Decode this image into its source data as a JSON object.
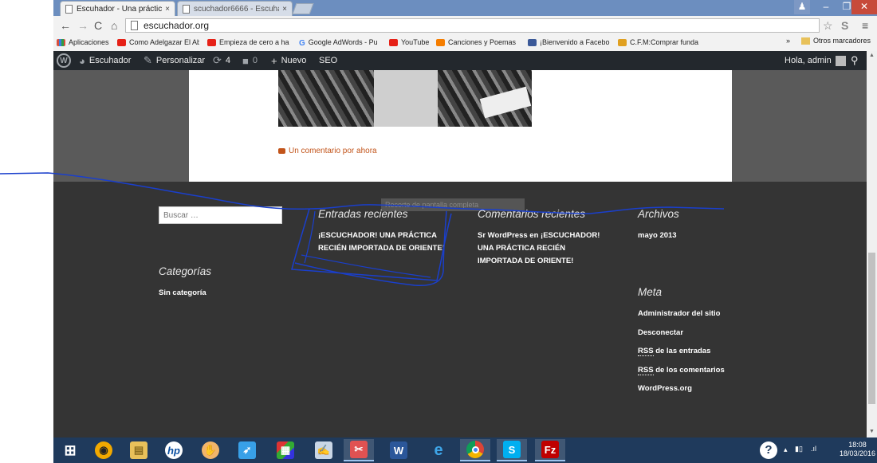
{
  "browser": {
    "tabs": [
      {
        "title": "Escuhador - Una práctica",
        "close": "×",
        "active": true
      },
      {
        "title": "scuchador6666 - Escuhad",
        "close": "×",
        "active": false
      }
    ],
    "url": "escuchador.org",
    "bookmarks": [
      {
        "label": "Aplicaciones",
        "icon": "apps-grid-icon",
        "color": "#d94f3d"
      },
      {
        "label": "Como Adelgazar El Ab",
        "icon": "youtube-icon",
        "color": "#e62117"
      },
      {
        "label": "Empieza de cero a ha",
        "icon": "youtube-icon",
        "color": "#e62117"
      },
      {
        "label": "Google AdWords - Pu",
        "icon": "google-icon",
        "color": "#4285f4"
      },
      {
        "label": "YouTube",
        "icon": "youtube-icon",
        "color": "#e62117"
      },
      {
        "label": "Canciones y Poemas",
        "icon": "blogger-icon",
        "color": "#f57d00"
      },
      {
        "label": "¡Bienvenido a Facebo",
        "icon": "facebook-icon",
        "color": "#3b5998"
      },
      {
        "label": "C.F.M:Comprar funda",
        "icon": "star-icon",
        "color": "#e0a020"
      }
    ],
    "bookmarks_more": "»",
    "other_bookmarks": "Otros marcadores"
  },
  "adminbar": {
    "site_name": "Escuhador",
    "customize": "Personalizar",
    "updates": "4",
    "comments": "0",
    "new": "Nuevo",
    "seo": "SEO",
    "greeting": "Hola, admin"
  },
  "post": {
    "comment_link": "Un comentario por ahora"
  },
  "footer": {
    "search_placeholder": "Buscar …",
    "tooltip": "Recorte de pantalla completa",
    "recent_posts": {
      "title": "Entradas recientes",
      "items": [
        "¡ESCUCHADOR! UNA PRÁCTICA RECIÉN IMPORTADA DE ORIENTE!"
      ]
    },
    "recent_comments": {
      "title": "Comentarios recientes",
      "author": "Sr WordPress",
      "connector": "en",
      "post": "¡ESCUCHADOR! UNA PRÁCTICA RECIÉN IMPORTADA DE ORIENTE!"
    },
    "archives": {
      "title": "Archivos",
      "items": [
        "mayo 2013"
      ]
    },
    "categories": {
      "title": "Categorías",
      "items": [
        "Sin categoría"
      ]
    },
    "meta": {
      "title": "Meta",
      "admin": "Administrador del sitio",
      "logout": "Desconectar",
      "rss_abbr": "RSS",
      "rss_entries": "de las entradas",
      "rss_comments": "de los comentarios",
      "wordpress": "WordPress.org"
    }
  },
  "taskbar": {
    "apps": [
      "start-icon",
      "media-player-icon",
      "file-explorer-icon",
      "hp-icon",
      "hand-icon",
      "rocket-icon",
      "game-icon",
      "paint-icon",
      "snipping-tool-icon",
      "word-icon",
      "internet-explorer-icon",
      "chrome-icon",
      "skype-icon",
      "filezilla-icon"
    ],
    "time": "18:08",
    "date": "18/03/2016"
  },
  "colors": {
    "footer_bg": "#343434",
    "adminbar_bg": "#23282d",
    "accent_link": "#c2541a",
    "scribble": "#1a3fcc"
  }
}
